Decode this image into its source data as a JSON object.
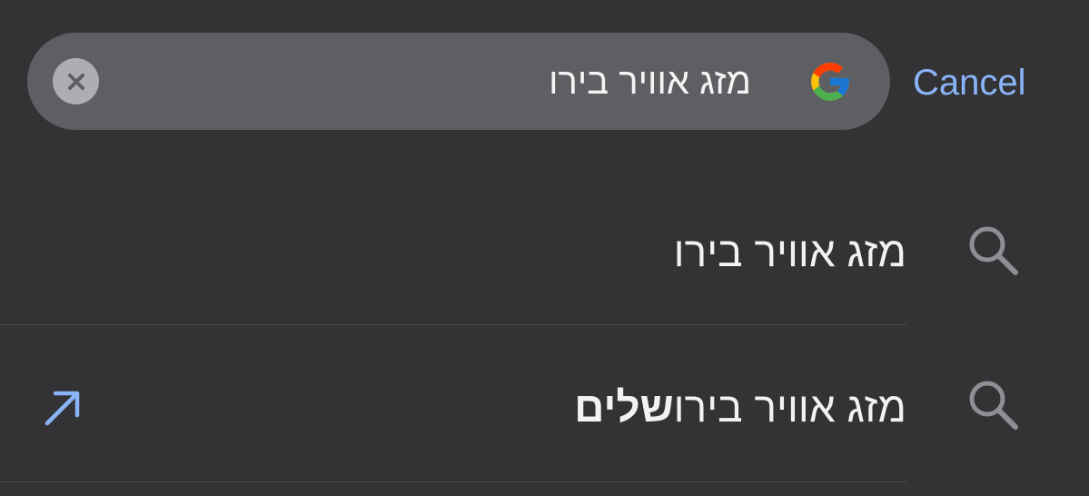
{
  "search": {
    "value": "מזג אוויר בירו",
    "clear_icon": "clear-circle-icon",
    "engine_icon": "google-g-icon"
  },
  "header": {
    "cancel_label": "Cancel"
  },
  "suggestions": [
    {
      "icon": "search-icon",
      "text": "מזג אוויר בירו",
      "typed_part": "מזג אוויר בירו",
      "completion_part": ""
    },
    {
      "icon": "search-icon",
      "text": "מזג אוויר בירושלים",
      "typed_part": "מזג אוויר בירו",
      "completion_part": "שלים",
      "action_icon": "fill-query-arrow-icon"
    }
  ],
  "colors": {
    "background": "#333335",
    "search_field": "#5d5f63",
    "accent": "#8ab4f8",
    "text": "#f2f2f2",
    "icon_gray": "#8e8e93"
  }
}
